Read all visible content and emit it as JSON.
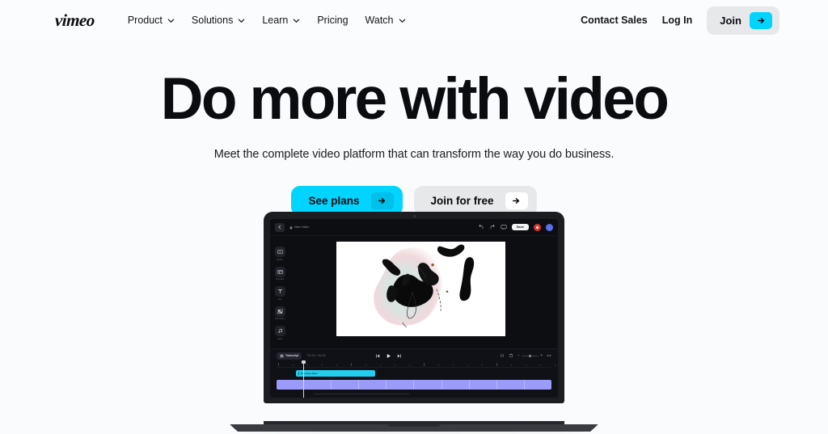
{
  "brand": {
    "logo_text": "vimeo",
    "accent_cyan": "#00d4ff",
    "accent_cyan_dark": "#00bfe8",
    "text_dark": "#0b0c10",
    "pill_gray": "#e6e8ea",
    "page_bg": "#fafbfc"
  },
  "header": {
    "nav": [
      {
        "label": "Product",
        "has_chevron": true,
        "icon": "chevron-down-icon"
      },
      {
        "label": "Solutions",
        "has_chevron": true,
        "icon": "chevron-down-icon"
      },
      {
        "label": "Learn",
        "has_chevron": true,
        "icon": "chevron-down-icon"
      },
      {
        "label": "Pricing",
        "has_chevron": false,
        "icon": ""
      },
      {
        "label": "Watch",
        "has_chevron": true,
        "icon": "chevron-down-icon"
      }
    ],
    "contact_sales": "Contact Sales",
    "log_in": "Log In",
    "join": "Join",
    "join_arrow_icon": "arrow-right-icon"
  },
  "hero": {
    "heading": "Do more with video",
    "subheading": "Meet the complete video platform that can transform the way you do business.",
    "cta_primary": {
      "label": "See plans",
      "icon": "arrow-right-icon"
    },
    "cta_secondary": {
      "label": "Join for free",
      "icon": "arrow-right-icon"
    }
  },
  "editor": {
    "back_icon": "back-arrow-icon",
    "lock_icon": "lock-icon",
    "project_title": "New Video",
    "toolbar": {
      "undo_icon": "undo-icon",
      "redo_icon": "redo-icon",
      "comment_icon": "comment-icon",
      "save_label": "Save",
      "record_icon": "record-icon",
      "avatar_label": ""
    },
    "sidebar": [
      {
        "label": "Media",
        "icon": "media-icon"
      },
      {
        "label": "Template",
        "icon": "template-icon"
      },
      {
        "label": "Text",
        "icon": "text-icon"
      },
      {
        "label": "Transitions",
        "icon": "transitions-icon"
      },
      {
        "label": "Audio",
        "icon": "audio-icon"
      }
    ],
    "timeline": {
      "transcript_label": "Transcript",
      "transcript_icon": "transcript-icon",
      "timecode": "00:04 / 00:40",
      "skip_back_icon": "skip-back-icon",
      "play_icon": "play-icon",
      "skip_forward_icon": "skip-forward-icon",
      "split_icon": "split-icon",
      "delete_icon": "trash-icon",
      "zoom_out_icon": "zoom-out-icon",
      "zoom_in_icon": "zoom-in-icon",
      "fit_icon": "fit-to-screen-icon",
      "text_clip_label": "Kia Goes Here"
    }
  }
}
